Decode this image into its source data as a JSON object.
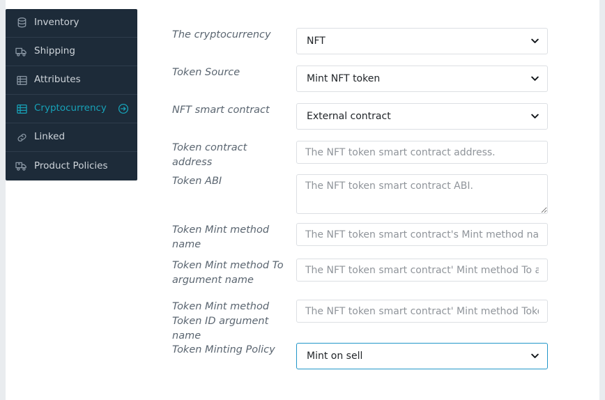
{
  "theme": {
    "sidebar_bg": "#1d2b39",
    "sidebar_text": "#ced4da",
    "sidebar_active": "#17a2b8",
    "page_bg": "#e9ecef",
    "label_text": "#5a6570",
    "focus_border": "#2196c9",
    "input_border": "#dcdfe3",
    "placeholder": "#8f949a"
  },
  "sidebar": {
    "items": [
      {
        "label": "Inventory",
        "icon": "database-icon",
        "active": false,
        "trailing_icon": null
      },
      {
        "label": "Shipping",
        "icon": "truck-icon",
        "active": false,
        "trailing_icon": null
      },
      {
        "label": "Attributes",
        "icon": "list-icon",
        "active": false,
        "trailing_icon": null
      },
      {
        "label": "Cryptocurrency",
        "icon": "list-icon",
        "active": true,
        "trailing_icon": "arrow-circle-right-icon"
      },
      {
        "label": "Linked",
        "icon": "link-icon",
        "active": false,
        "trailing_icon": null
      },
      {
        "label": "Product Policies",
        "icon": "ambulance-icon",
        "active": false,
        "trailing_icon": null
      }
    ]
  },
  "form": {
    "fields": [
      {
        "name": "the-cryptocurrency",
        "label": "The cryptocurrency",
        "control": "select",
        "value": "NFT",
        "focused": false,
        "options": [
          "NFT"
        ]
      },
      {
        "name": "token-source",
        "label": "Token Source",
        "control": "select",
        "value": "Mint NFT token",
        "focused": false,
        "options": [
          "Mint NFT token"
        ]
      },
      {
        "name": "nft-smart-contract",
        "label": "NFT smart contract",
        "control": "select",
        "value": "External contract",
        "focused": false,
        "options": [
          "External contract"
        ]
      },
      {
        "name": "token-contract-address",
        "label": "Token contract address",
        "control": "text",
        "value": "",
        "placeholder": "The NFT token smart contract address."
      },
      {
        "name": "token-abi",
        "label": "Token ABI",
        "control": "textarea",
        "value": "",
        "placeholder": "The NFT token smart contract ABI."
      },
      {
        "name": "token-mint-method-name",
        "label": "Token Mint method name",
        "control": "text",
        "value": "",
        "placeholder": "The NFT token smart contract's Mint method name. It is"
      },
      {
        "name": "token-mint-method-to-argument-name",
        "label": "Token Mint method To argument name",
        "control": "text",
        "value": "",
        "placeholder": "The NFT token smart contract' Mint method To argument"
      },
      {
        "name": "token-mint-method-token-id-argument-name",
        "label": "Token Mint method Token ID argument name",
        "control": "text",
        "value": "",
        "placeholder": "The NFT token smart contract' Mint method Token ID arg"
      },
      {
        "name": "token-minting-policy",
        "label": "Token Minting Policy",
        "control": "select",
        "value": "Mint on sell",
        "focused": true,
        "options": [
          "Mint on sell"
        ]
      }
    ]
  }
}
